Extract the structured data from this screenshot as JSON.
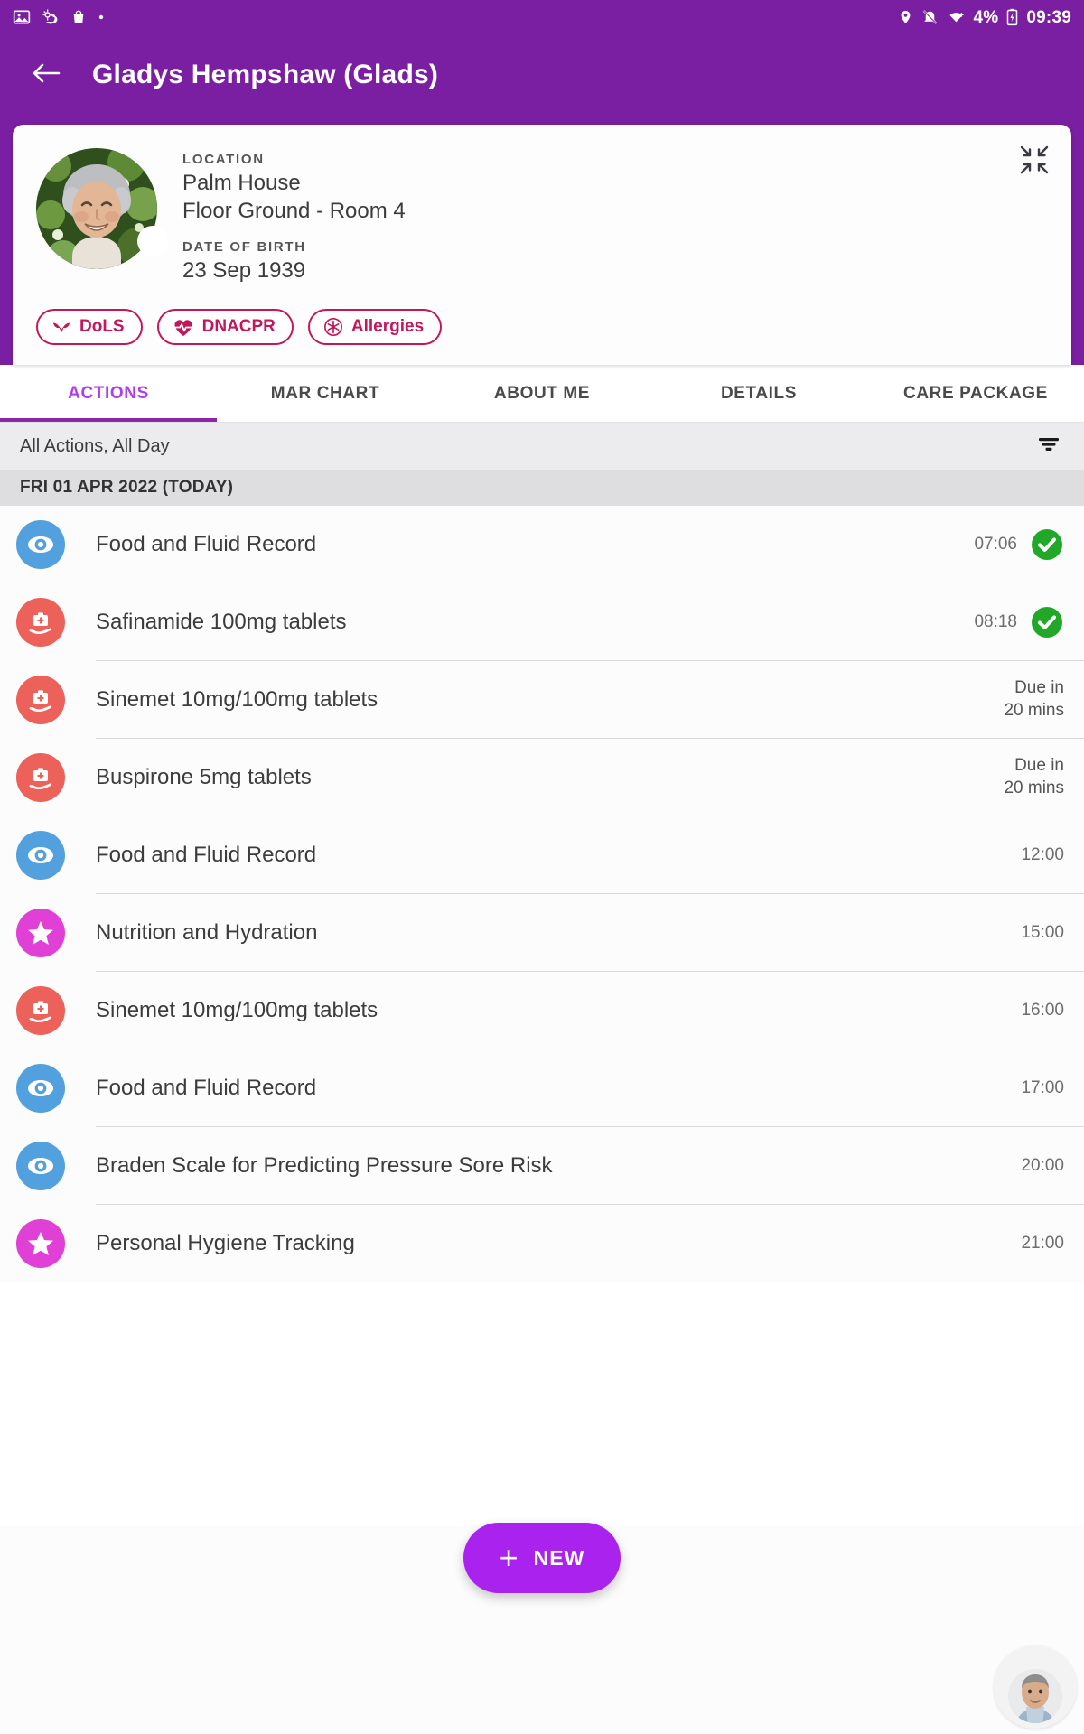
{
  "status_bar": {
    "left_icons": [
      "image-icon",
      "weather-icon",
      "shopping-bag-icon",
      "dot-icon"
    ],
    "right_icons": [
      "location-pin-icon",
      "notifications-muted-icon",
      "wifi-icon",
      "battery-charging-icon"
    ],
    "battery_percent": "4%",
    "clock": "09:39"
  },
  "app_bar": {
    "back_icon": "arrow-left-icon",
    "title": "Gladys Hempshaw (Glads)"
  },
  "patient_card": {
    "collapse_icon": "collapse-arrows-icon",
    "avatar_icon": "patient-photo",
    "location_label": "LOCATION",
    "location_line1": "Palm House",
    "location_line2": "Floor Ground - Room 4",
    "dob_label": "DATE OF BIRTH",
    "dob_value": "23 Sep 1939",
    "chip_color": "#C2185B",
    "chips": [
      {
        "label": "DoLS",
        "icon": "caring-hands-icon"
      },
      {
        "label": "DNACPR",
        "icon": "heart-pulse-icon"
      },
      {
        "label": "Allergies",
        "icon": "allergy-asterisk-icon"
      }
    ]
  },
  "tabs": {
    "active_index": 0,
    "active_color": "#B13CEB",
    "items": [
      {
        "label": "ACTIONS"
      },
      {
        "label": "MAR CHART"
      },
      {
        "label": "ABOUT ME"
      },
      {
        "label": "DETAILS"
      },
      {
        "label": "CARE PACKAGE"
      }
    ]
  },
  "filter_bar": {
    "text": "All Actions, All Day",
    "filter_icon": "filter-icon"
  },
  "date_header": {
    "text": "FRI 01 APR 2022 (TODAY)"
  },
  "actions": [
    {
      "icon": "eye-icon",
      "icon_kind": "eye",
      "icon_color": "#53A0DE",
      "title": "Food and Fluid Record",
      "time": "07:06",
      "status": "complete"
    },
    {
      "icon": "medication-icon",
      "icon_kind": "med",
      "icon_color": "#EC6159",
      "title": "Safinamide 100mg tablets",
      "time": "08:18",
      "status": "complete"
    },
    {
      "icon": "medication-icon",
      "icon_kind": "med",
      "icon_color": "#EC6159",
      "title": "Sinemet 10mg/100mg tablets",
      "time": "Due in\n20 mins",
      "status": "due"
    },
    {
      "icon": "medication-icon",
      "icon_kind": "med",
      "icon_color": "#EC6159",
      "title": "Buspirone 5mg tablets",
      "time": "Due in\n20 mins",
      "status": "due"
    },
    {
      "icon": "eye-icon",
      "icon_kind": "eye",
      "icon_color": "#53A0DE",
      "title": "Food and Fluid Record",
      "time": "12:00",
      "status": "pending"
    },
    {
      "icon": "star-icon",
      "icon_kind": "star",
      "icon_color": "#E040D6",
      "title": "Nutrition and Hydration",
      "time": "15:00",
      "status": "pending"
    },
    {
      "icon": "medication-icon",
      "icon_kind": "med",
      "icon_color": "#EC6159",
      "title": "Sinemet 10mg/100mg tablets",
      "time": "16:00",
      "status": "pending"
    },
    {
      "icon": "eye-icon",
      "icon_kind": "eye",
      "icon_color": "#53A0DE",
      "title": "Food and Fluid Record",
      "time": "17:00",
      "status": "pending"
    },
    {
      "icon": "eye-icon",
      "icon_kind": "eye",
      "icon_color": "#53A0DE",
      "title": "Braden Scale for Predicting Pressure Sore Risk",
      "time": "20:00",
      "status": "pending"
    },
    {
      "icon": "star-icon",
      "icon_kind": "star",
      "icon_color": "#E040D6",
      "title": "Personal Hygiene Tracking",
      "time": "21:00",
      "status": "pending"
    }
  ],
  "fab": {
    "label": "NEW",
    "icon": "plus-icon",
    "color": "#AA22EE"
  },
  "user_avatar": {
    "icon": "user-avatar"
  },
  "theme": {
    "app_bar": "#7B1FA2",
    "complete_green": "#22A828",
    "filter_bar_bg": "#ececee",
    "date_header_bg": "#dedee1"
  }
}
